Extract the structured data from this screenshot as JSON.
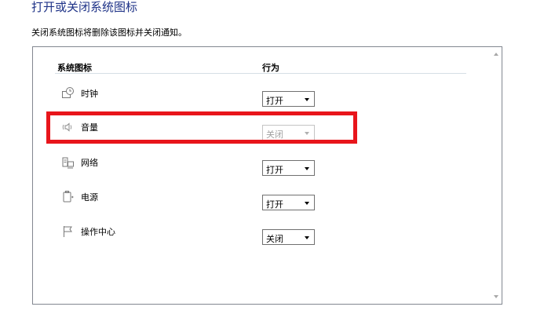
{
  "header": {
    "title": "打开或关闭系统图标",
    "description": "关闭系统图标将删除该图标并关闭通知。"
  },
  "table": {
    "col_icon": "系统图标",
    "col_behavior": "行为",
    "rows": [
      {
        "icon": "clock-icon",
        "label": "时钟",
        "behavior": "打开",
        "disabled": false
      },
      {
        "icon": "volume-icon",
        "label": "音量",
        "behavior": "关闭",
        "disabled": true
      },
      {
        "icon": "network-icon",
        "label": "网络",
        "behavior": "打开",
        "disabled": false
      },
      {
        "icon": "power-icon",
        "label": "电源",
        "behavior": "打开",
        "disabled": false
      },
      {
        "icon": "action-center-flag-icon",
        "label": "操作中心",
        "behavior": "关闭",
        "disabled": false
      }
    ]
  },
  "colors": {
    "title": "#1e3287",
    "highlight": "#e8151b"
  }
}
